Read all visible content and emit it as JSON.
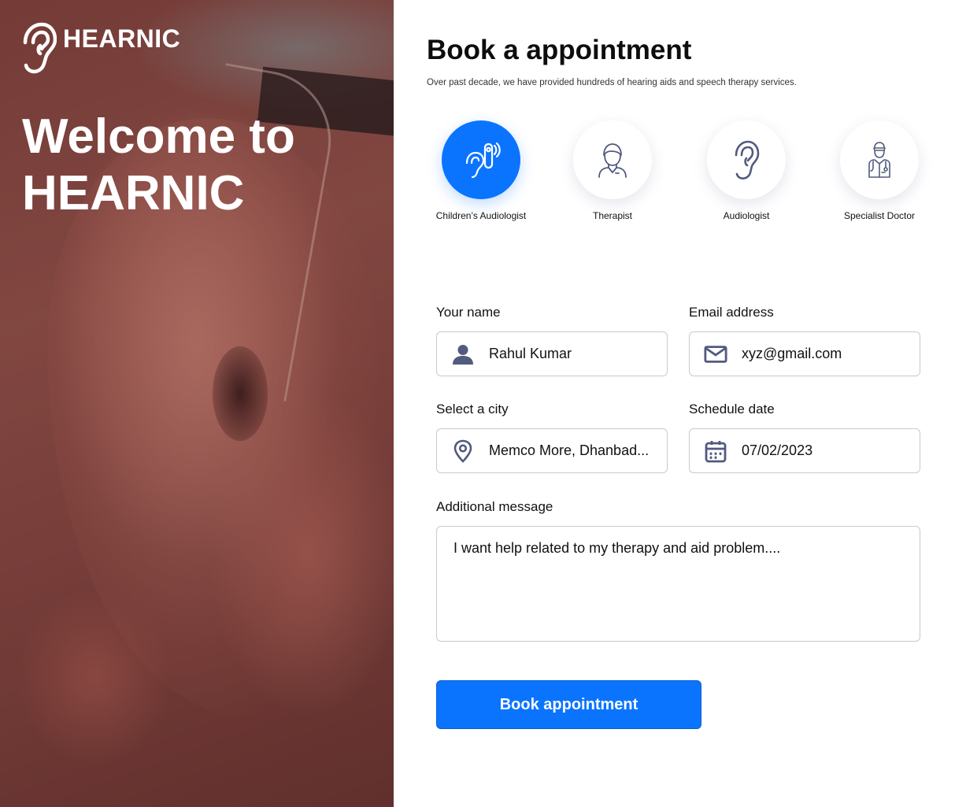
{
  "brand": {
    "name": "HEARNIC",
    "icon": "ear-icon"
  },
  "hero": {
    "title_line1": "Welcome to",
    "title_line2": "HEARNIC"
  },
  "booking": {
    "title": "Book a appointment",
    "subtitle": "Over past decade, we have provided hundreds of hearing aids and speech therapy services."
  },
  "categories": [
    {
      "label": "Children’s Audiologist",
      "icon": "hearing-aid-icon",
      "selected": true
    },
    {
      "label": "Therapist",
      "icon": "therapist-icon",
      "selected": false
    },
    {
      "label": "Audiologist",
      "icon": "ear-icon",
      "selected": false
    },
    {
      "label": "Specialist Doctor",
      "icon": "doctor-icon",
      "selected": false
    }
  ],
  "form": {
    "name": {
      "label": "Your name",
      "value": "Rahul Kumar",
      "icon": "person-icon"
    },
    "email": {
      "label": "Email address",
      "value": "xyz@gmail.com",
      "icon": "mail-icon"
    },
    "city": {
      "label": "Select a city",
      "value": "Memco More, Dhanbad...",
      "icon": "location-pin-icon"
    },
    "date": {
      "label": "Schedule date",
      "value": "07/02/2023",
      "icon": "calendar-icon"
    },
    "message": {
      "label": "Additional message",
      "value": "I want help related to my therapy and aid problem...."
    },
    "submit_label": "Book appointment"
  },
  "colors": {
    "accent": "#0a74ff",
    "icon": "#525a7e",
    "border": "#c9c9d1"
  }
}
